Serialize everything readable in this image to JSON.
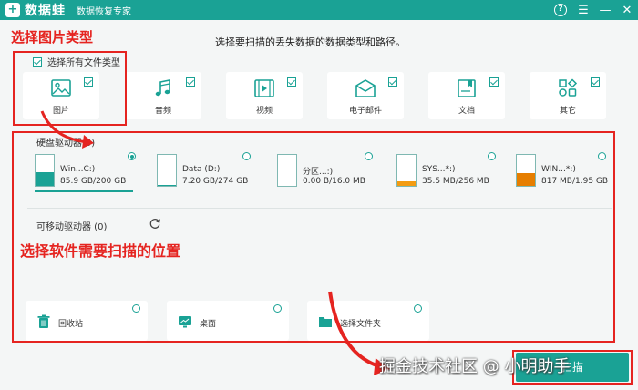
{
  "app": {
    "logo_glyph": "+",
    "name": "数据蛙",
    "subtitle": "数据恢复专家",
    "controls": {
      "help": "?",
      "menu": "☰",
      "minimize": "—",
      "close": "✕"
    }
  },
  "instruction": "选择要扫描的丢失数据的数据类型和路径。",
  "annotations": {
    "select_types": "选择图片类型",
    "select_location": "选择软件需要扫描的位置"
  },
  "file_types": {
    "select_all_label": "选择所有文件类型",
    "items": [
      {
        "label": "图片",
        "icon": "image-icon",
        "checked": true
      },
      {
        "label": "音频",
        "icon": "music-icon",
        "checked": true
      },
      {
        "label": "视频",
        "icon": "video-icon",
        "checked": true
      },
      {
        "label": "电子邮件",
        "icon": "email-icon",
        "checked": true
      },
      {
        "label": "文档",
        "icon": "document-icon",
        "checked": true
      },
      {
        "label": "其它",
        "icon": "other-icon",
        "checked": true
      }
    ]
  },
  "disks": {
    "header": "硬盘驱动器(5)",
    "items": [
      {
        "name": "Win...C:)",
        "size": "85.9 GB/200 GB",
        "usage": 0.43,
        "color": "#1aa295",
        "selected": true
      },
      {
        "name": "Data (D:)",
        "size": "7.20 GB/274 GB",
        "usage": 0.03,
        "color": "#1aa295",
        "selected": false
      },
      {
        "name": "分区...:)",
        "size": "0.00  B/16.0 MB",
        "usage": 0.0,
        "color": "#1aa295",
        "selected": false
      },
      {
        "name": "SYS...*:)",
        "size": "35.5 MB/256 MB",
        "usage": 0.14,
        "color": "#f39c12",
        "selected": false
      },
      {
        "name": "WIN...*:)",
        "size": "817 MB/1.95 GB",
        "usage": 0.42,
        "color": "#e67e00",
        "selected": false
      }
    ]
  },
  "removable": {
    "label": "可移动驱动器 (0)"
  },
  "locations": [
    {
      "label": "回收站",
      "icon": "recycle-bin-icon"
    },
    {
      "label": "桌面",
      "icon": "desktop-icon"
    },
    {
      "label": "选择文件夹",
      "icon": "folder-icon"
    }
  ],
  "next_button": "扫描",
  "watermark": "掘金技术社区 @ 小明助手",
  "colors": {
    "accent": "#1aa295",
    "annotation": "#e52420"
  }
}
